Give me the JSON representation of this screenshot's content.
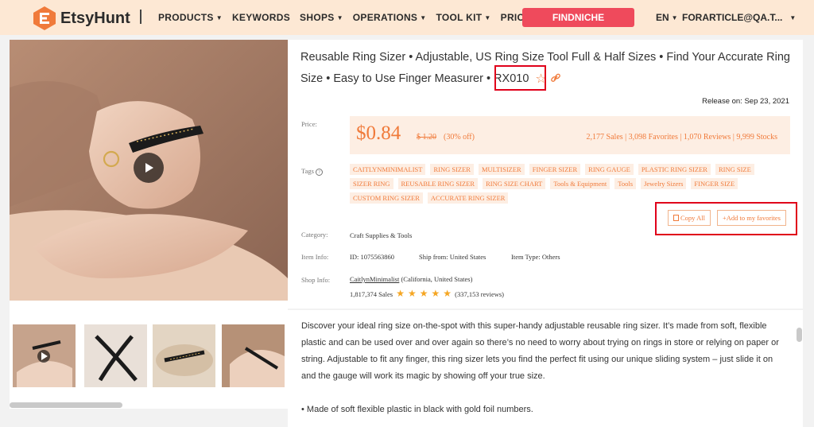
{
  "brand": {
    "name": "EtsyHunt",
    "accent": "#f07a3a"
  },
  "nav": {
    "items": [
      {
        "label": "PRODUCTS",
        "has_caret": true
      },
      {
        "label": "KEYWORDS",
        "has_caret": false
      },
      {
        "label": "SHOPS",
        "has_caret": true
      },
      {
        "label": "OPERATIONS",
        "has_caret": true
      },
      {
        "label": "TOOL KIT",
        "has_caret": true
      },
      {
        "label": "PRICING",
        "has_caret": false
      }
    ],
    "findniche": "FINDNICHE",
    "language": "EN",
    "account": "FORARTICLE@QA.T..."
  },
  "product": {
    "title": "Reusable Ring Sizer • Adjustable, US Ring Size Tool Full & Half Sizes • Find Your Accurate Ring Size • Easy to Use Finger Measurer • RX010",
    "release": "Release on: Sep 23, 2021",
    "labels": {
      "price": "Price:",
      "tags": "Tags",
      "category": "Category:",
      "item_info": "Item Info:",
      "shop_info": "Shop Info:"
    },
    "price": "$0.84",
    "old_price": "$ 1.20",
    "discount": "(30% off)",
    "stats": "2,177 Sales | 3,098 Favorites | 1,070 Reviews | 9,999 Stocks",
    "tags": [
      "CAITLYNMINIMALIST",
      "RING SIZER",
      "MULTISIZER",
      "FINGER SIZER",
      "RING GAUGE",
      "PLASTIC RING SIZER",
      "RING SIZE",
      "SIZER RING",
      "REUSABLE RING SIZER",
      "RING SIZE CHART",
      "Tools & Equipment",
      "Tools",
      "Jewelry Sizers",
      "FINGER SIZE",
      "CUSTOM RING SIZER",
      "ACCURATE RING SIZER"
    ],
    "buttons": {
      "copy_all": "Copy All",
      "add_favorites": "+Add to my favorites"
    },
    "category": "Craft Supplies & Tools",
    "item_id": "ID: 1075563860",
    "ship_from": "Ship from: United States",
    "item_type": "Item Type: Others",
    "shop_name": "CaitlynMinimalist",
    "shop_location": "(California, United States)",
    "shop_sales": "1,817,374 Sales",
    "shop_rating_stars": 5,
    "shop_reviews": "(337,153 reviews)"
  },
  "description": {
    "paragraph": "Discover your ideal ring size on-the-spot with this super-handy adjustable reusable ring sizer. It’s made from soft, flexible plastic and can be used over and over again so there’s no need to worry about trying on rings in store or relying on paper or string. Adjustable to fit any finger, this ring sizer lets you find the perfect fit using our unique sliding system – just slide it on and the gauge will work its magic by showing off your true size.",
    "bullet": "• Made of soft flexible plastic in black with gold foil numbers."
  }
}
